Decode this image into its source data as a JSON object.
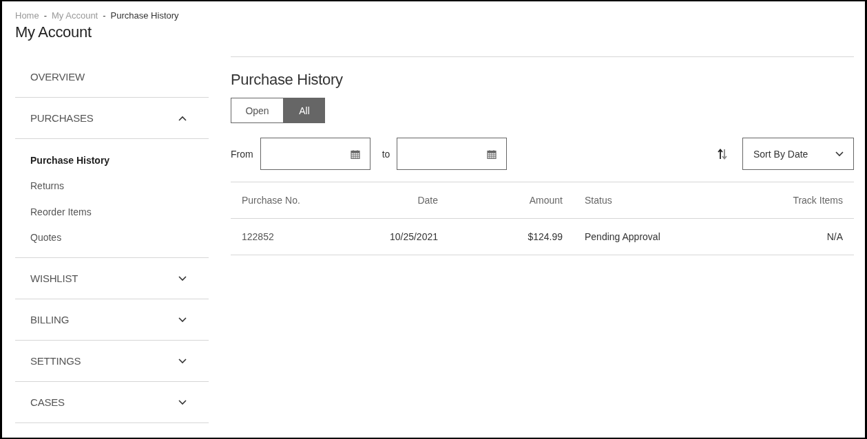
{
  "breadcrumb": [
    {
      "kind": "link",
      "label": "Home"
    },
    {
      "kind": "separator",
      "label": "-"
    },
    {
      "kind": "link",
      "label": "My Account"
    },
    {
      "kind": "separator",
      "label": "-"
    },
    {
      "kind": "current",
      "label": "Purchase History"
    }
  ],
  "page_title": "My Account",
  "sidebar": {
    "items": [
      {
        "kind": "link",
        "label": "OVERVIEW"
      },
      {
        "kind": "section",
        "label": "PURCHASES",
        "expanded": true,
        "children": [
          {
            "label": "Purchase History",
            "selected": true
          },
          {
            "label": "Returns",
            "selected": false
          },
          {
            "label": "Reorder Items",
            "selected": false
          },
          {
            "label": "Quotes",
            "selected": false
          }
        ]
      },
      {
        "kind": "section",
        "label": "WISHLIST",
        "expanded": false
      },
      {
        "kind": "section",
        "label": "BILLING",
        "expanded": false
      },
      {
        "kind": "section",
        "label": "SETTINGS",
        "expanded": false
      },
      {
        "kind": "section",
        "label": "CASES",
        "expanded": false
      }
    ]
  },
  "main": {
    "title": "Purchase History",
    "filter_tabs": [
      {
        "label": "Open",
        "selected": false
      },
      {
        "label": "All",
        "selected": true
      }
    ],
    "date_filter": {
      "from_label": "From",
      "to_label": "to"
    },
    "sort": {
      "value": "Sort By Date"
    },
    "table": {
      "columns": [
        "Purchase No.",
        "Date",
        "Amount",
        "Status",
        "Track Items"
      ],
      "rows": [
        [
          "122852",
          "10/25/2021",
          "$124.99",
          "Pending Approval",
          "N/A"
        ]
      ]
    }
  }
}
